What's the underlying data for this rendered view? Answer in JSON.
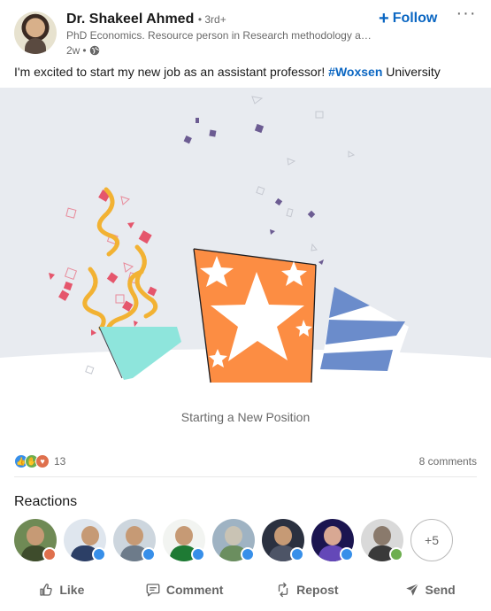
{
  "author": {
    "name": "Dr. Shakeel Ahmed",
    "degree": "3rd+",
    "headline": "PhD Economics. Resource person in Research methodology and Data Analysis",
    "posted": "2w"
  },
  "follow": {
    "label": "Follow"
  },
  "post": {
    "text_before": "I'm excited to start my new job as an assistant professor! ",
    "hashtag": "#Woxsen",
    "text_after": " University"
  },
  "caption": "Starting a New Position",
  "counts": {
    "reactions": "13",
    "comments": "8 comments"
  },
  "reactions": {
    "title": "Reactions",
    "more": "+5"
  },
  "actions": {
    "like": "Like",
    "comment": "Comment",
    "repost": "Repost",
    "send": "Send"
  },
  "icons": [
    "globe-icon",
    "plus-icon",
    "more-icon",
    "like-icon",
    "comment-icon",
    "repost-icon",
    "send-icon"
  ],
  "colors": {
    "link": "#0a66c2",
    "banner_bg": "#e8ebf0",
    "orange": "#fc8d43",
    "blue": "#6b8ccb",
    "mint": "#8ee5dc",
    "streamer": "#f2b233"
  }
}
